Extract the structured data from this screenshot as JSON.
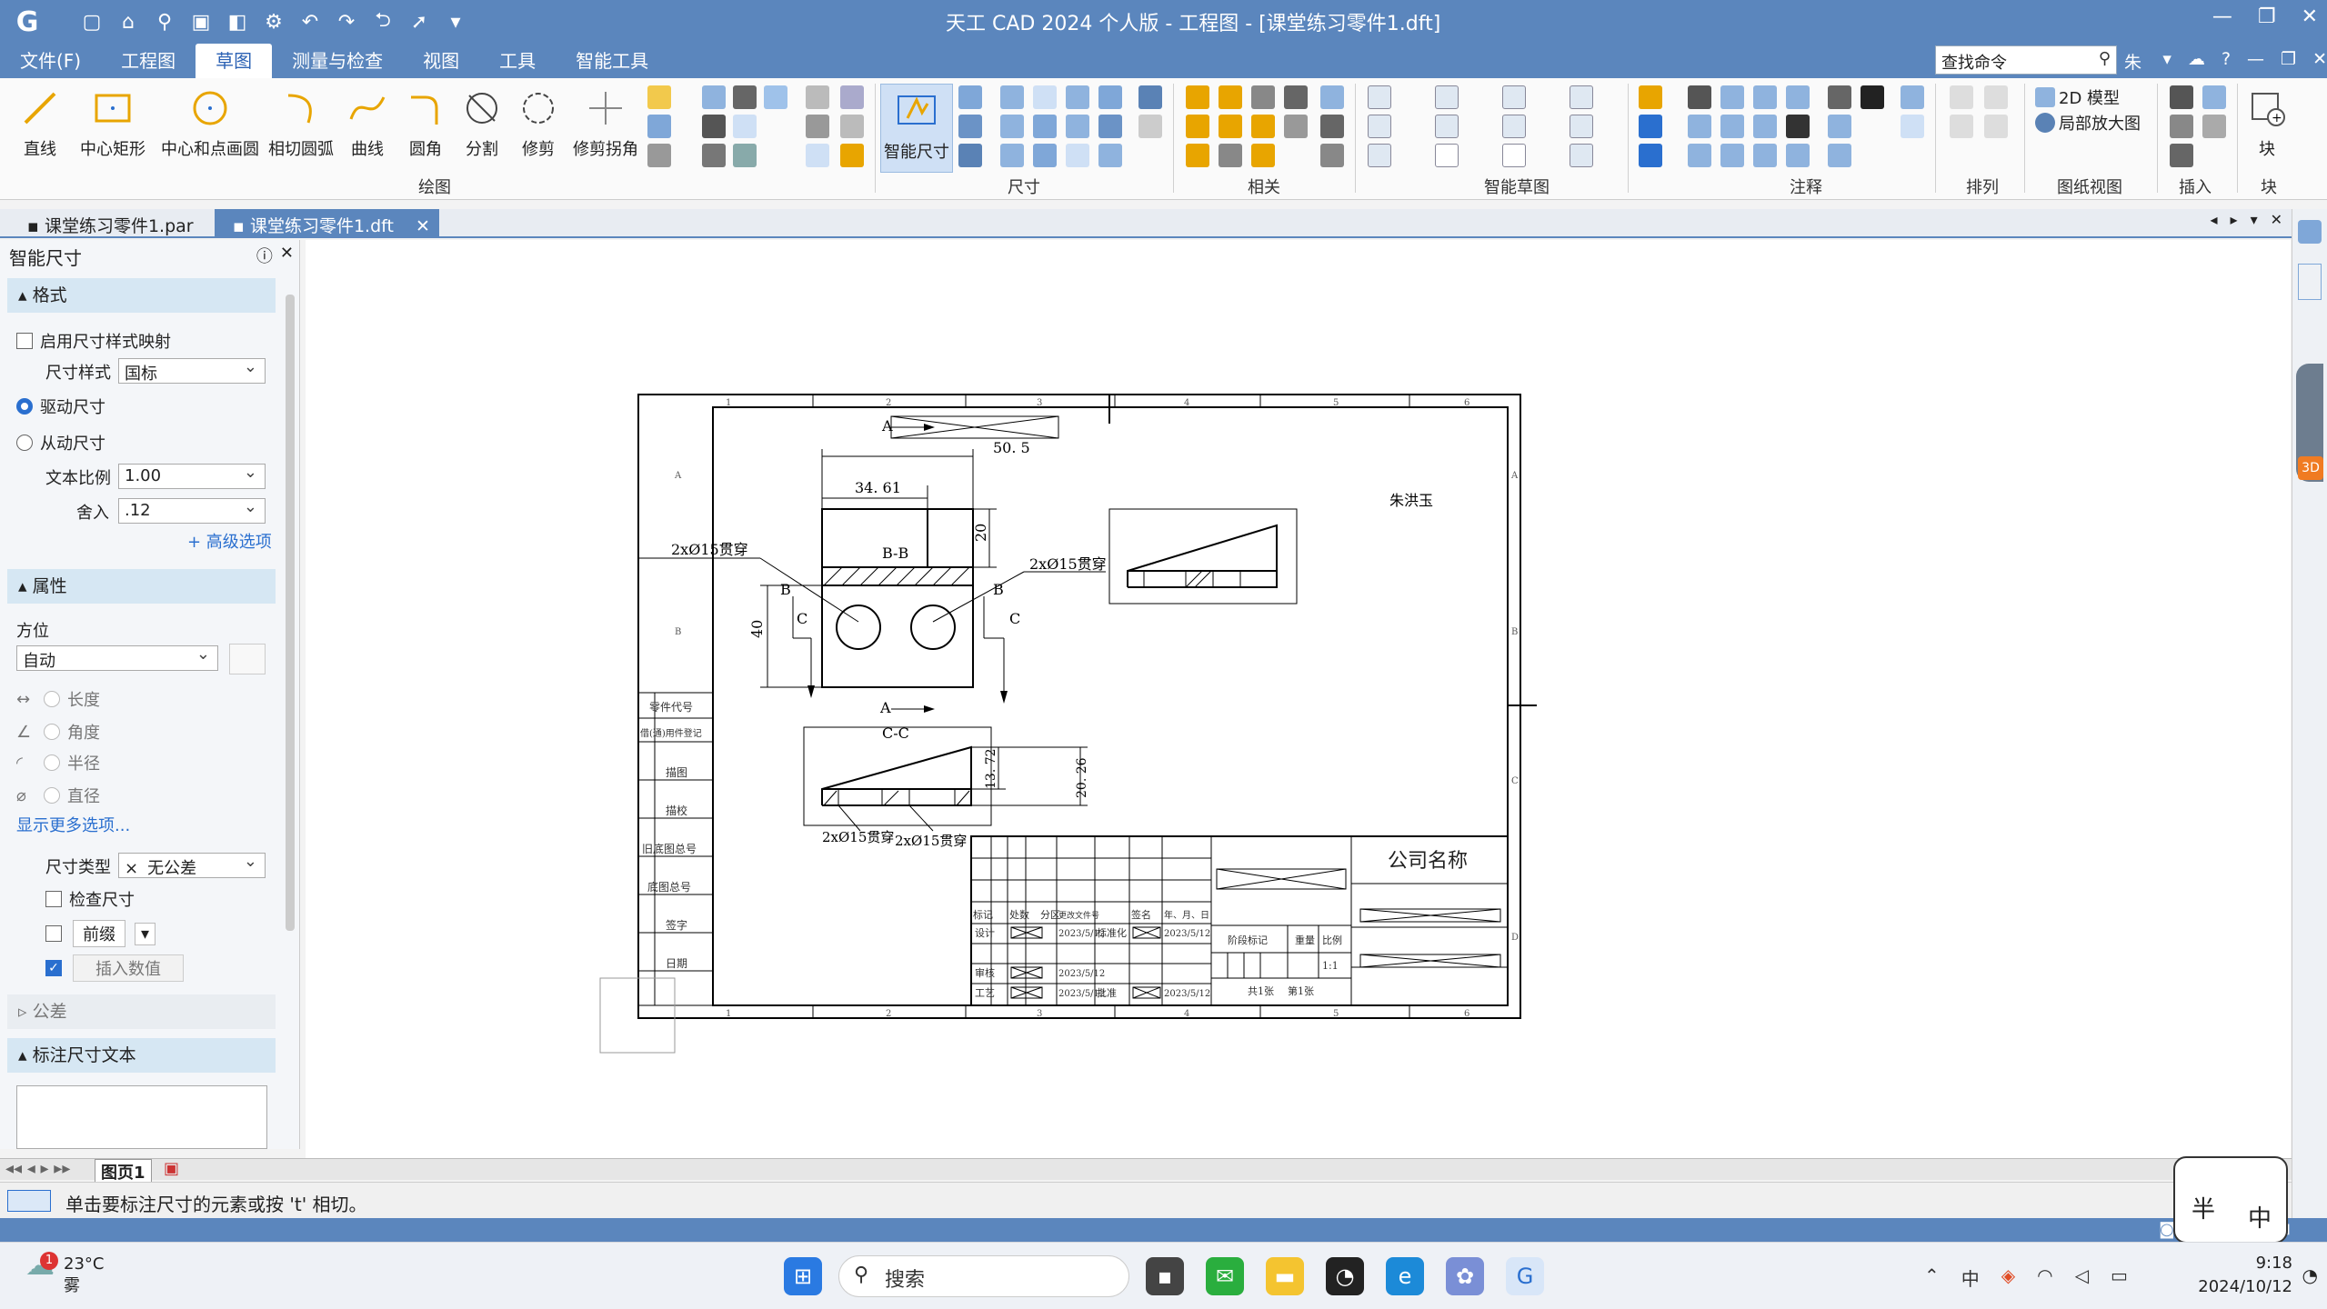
{
  "window": {
    "title": "天工 CAD 2024 个人版 - 工程图 - [课堂练习零件1.dft]"
  },
  "menu": {
    "items": [
      "文件(F)",
      "工程图",
      "草图",
      "测量与检查",
      "视图",
      "工具",
      "智能工具"
    ],
    "active_index": 2
  },
  "search": {
    "placeholder": "查找命令"
  },
  "user": {
    "name": "朱洪玉"
  },
  "ribbon": {
    "draw_tools": [
      "直线",
      "中心矩形",
      "中心和点画圆",
      "相切圆弧",
      "曲线",
      "圆角",
      "分割",
      "修剪",
      "修剪拐角"
    ],
    "smart_dim": "智能尺寸",
    "groups": [
      "绘图",
      "尺寸",
      "相关",
      "智能草图",
      "注释",
      "排列",
      "图纸视图",
      "插入",
      "块"
    ],
    "view_items": [
      "2D 模型",
      "局部放大图"
    ],
    "block_label": "块"
  },
  "doc_tabs": [
    {
      "label": "课堂练习零件1.par",
      "active": false
    },
    {
      "label": "课堂练习零件1.dft",
      "active": true
    }
  ],
  "panel": {
    "title": "智能尺寸",
    "format_section": "格式",
    "enable_map": "启用尺寸样式映射",
    "dim_style_label": "尺寸样式",
    "dim_style_value": "国标",
    "driving": "驱动尺寸",
    "driven": "从动尺寸",
    "text_scale_label": "文本比例",
    "text_scale_value": "1.00",
    "round_label": "舍入",
    "round_value": ".12",
    "advanced": "+ 高级选项",
    "attr_section": "属性",
    "orient_label": "方位",
    "orient_value": "自动",
    "options": [
      "长度",
      "角度",
      "半径",
      "直径"
    ],
    "more": "显示更多选项...",
    "dim_type_label": "尺寸类型",
    "dim_type_value": "无公差",
    "check_dim": "检查尺寸",
    "prefix": "前缀",
    "insert_value": "插入数值",
    "tol_section": "公差",
    "text_section": "标注尺寸文本"
  },
  "drawing": {
    "section_bb": "B-B",
    "section_cc": "C-C",
    "dim_506": "50. 5",
    "dim_3461": "34. 61",
    "dim_20": "20",
    "dim_40": "40",
    "dim_1372": "13. 72",
    "dim_2026": "20. 26",
    "hole_note": "2xØ15贯穿",
    "label_a": "A",
    "label_b": "B",
    "label_c": "C",
    "author": "朱洪玉",
    "company": "公司名称",
    "date": "2023/5/12",
    "scale": "1:1",
    "side_labels": [
      "零件代号",
      "借(通)用件登记",
      "描图",
      "描校",
      "旧底图总号",
      "底图总号",
      "签字",
      "日期"
    ],
    "title_hdr": [
      "标记",
      "处数",
      "分区",
      "更改文件号",
      "签名",
      "年、月、日"
    ],
    "row_labels": [
      "设计",
      "标准化",
      "审核",
      "工艺",
      "批准"
    ],
    "stage_label": "阶段标记",
    "weight_label": "重量",
    "scale_label": "比例",
    "sheet_count": "共1张",
    "sheet_no": "第1张",
    "zone_cols": [
      "1",
      "2",
      "3",
      "4",
      "5",
      "6"
    ],
    "zone_rows": [
      "A",
      "B",
      "C",
      "D"
    ]
  },
  "sheet_tab": "图页1",
  "status": {
    "prompt": "单击要标注尺寸的元素或按 't' 相切。"
  },
  "ime": {
    "half": "半",
    "lang": "中"
  },
  "taskbar": {
    "temperature": "23°C",
    "weather": "雾",
    "badge": "1",
    "search": "搜索",
    "time": "9:18",
    "date": "2024/10/12",
    "tray_lang": "中"
  }
}
